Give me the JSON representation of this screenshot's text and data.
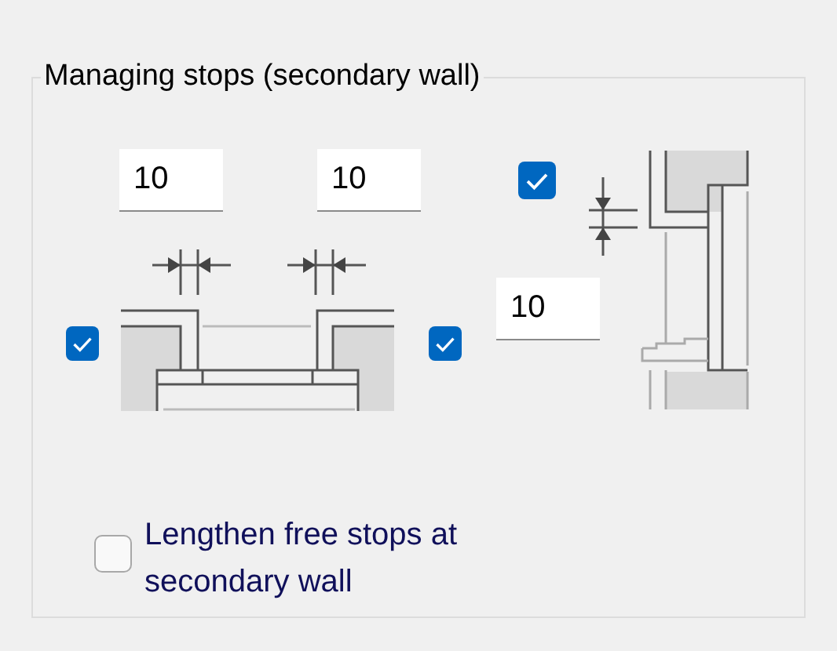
{
  "group": {
    "title": "Managing stops (secondary wall)"
  },
  "width_fields": [
    {
      "value": "10"
    },
    {
      "value": "10"
    }
  ],
  "width_checkboxes": [
    {
      "checked": true
    },
    {
      "checked": true
    }
  ],
  "height_checkbox": {
    "checked": true
  },
  "height_field": {
    "value": "10"
  },
  "option": {
    "label": "Lengthen free stops at secondary wall",
    "checked": false
  }
}
